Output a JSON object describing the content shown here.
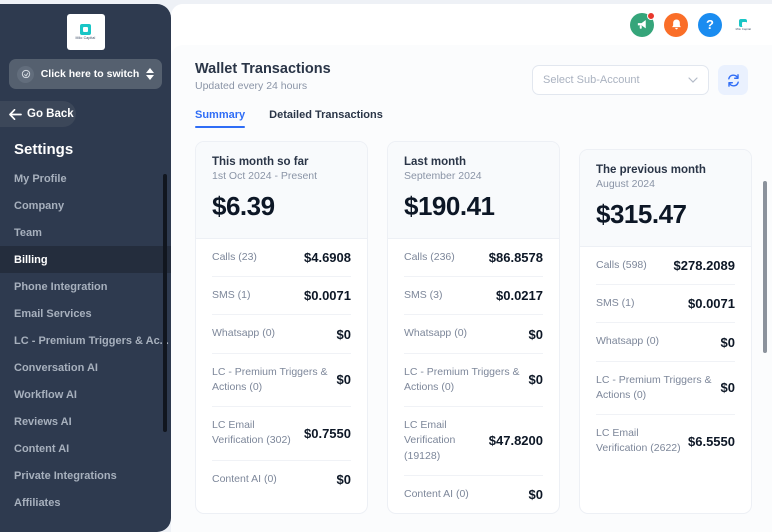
{
  "sidebar": {
    "logo_label": "Milo Capital",
    "switch": {
      "label": "Click here to switch",
      "icon": "switch-account-icon"
    },
    "go_back": {
      "label": "Go Back",
      "icon": "arrow-left-icon"
    },
    "section_title": "Settings",
    "items": [
      {
        "label": "My Profile",
        "active": false
      },
      {
        "label": "Company",
        "active": false
      },
      {
        "label": "Team",
        "active": false
      },
      {
        "label": "Billing",
        "active": true
      },
      {
        "label": "Phone Integration",
        "active": false
      },
      {
        "label": "Email Services",
        "active": false
      },
      {
        "label": "LC - Premium Triggers & Ac...",
        "active": false
      },
      {
        "label": "Conversation AI",
        "active": false
      },
      {
        "label": "Workflow AI",
        "active": false
      },
      {
        "label": "Reviews AI",
        "active": false
      },
      {
        "label": "Content AI",
        "active": false
      },
      {
        "label": "Private Integrations",
        "active": false
      },
      {
        "label": "Affiliates",
        "active": false
      }
    ]
  },
  "topbar": {
    "icons": [
      {
        "name": "announcement-icon",
        "has_badge": true,
        "color": "#35a57a"
      },
      {
        "name": "notification-bell-icon",
        "has_badge": false,
        "color": "#fa6e28"
      },
      {
        "name": "help-icon",
        "glyph": "?",
        "color": "#1a8cf0"
      },
      {
        "name": "brand-logo-icon",
        "label": "Milo Capital"
      }
    ]
  },
  "header": {
    "title": "Wallet Transactions",
    "subtitle": "Updated every 24 hours",
    "sub_account_select": {
      "placeholder": "Select Sub-Account",
      "value": ""
    },
    "refresh_label": "refresh-icon"
  },
  "tabs": [
    {
      "label": "Summary",
      "active": true
    },
    {
      "label": "Detailed Transactions",
      "active": false
    }
  ],
  "cards": [
    {
      "title": "This month so far",
      "range": "1st Oct 2024 - Present",
      "total": "$6.39",
      "shifted": false,
      "rows": [
        {
          "label": "Calls (23)",
          "value": "$4.6908"
        },
        {
          "label": "SMS (1)",
          "value": "$0.0071"
        },
        {
          "label": "Whatsapp (0)",
          "value": "$0"
        },
        {
          "label": "LC - Premium Triggers & Actions (0)",
          "value": "$0"
        },
        {
          "label": "LC Email Verification (302)",
          "value": "$0.7550"
        },
        {
          "label": "Content AI (0)",
          "value": "$0"
        }
      ]
    },
    {
      "title": "Last month",
      "range": "September 2024",
      "total": "$190.41",
      "shifted": false,
      "rows": [
        {
          "label": "Calls (236)",
          "value": "$86.8578"
        },
        {
          "label": "SMS (3)",
          "value": "$0.0217"
        },
        {
          "label": "Whatsapp (0)",
          "value": "$0"
        },
        {
          "label": "LC - Premium Triggers & Actions (0)",
          "value": "$0"
        },
        {
          "label": "LC Email Verification (19128)",
          "value": "$47.8200"
        },
        {
          "label": "Content AI (0)",
          "value": "$0"
        }
      ]
    },
    {
      "title": "The previous month",
      "range": "August 2024",
      "total": "$315.47",
      "shifted": true,
      "rows": [
        {
          "label": "Calls (598)",
          "value": "$278.2089"
        },
        {
          "label": "SMS (1)",
          "value": "$0.0071"
        },
        {
          "label": "Whatsapp (0)",
          "value": "$0"
        },
        {
          "label": "LC - Premium Triggers & Actions (0)",
          "value": "$0"
        },
        {
          "label": "LC Email Verification (2622)",
          "value": "$6.5550"
        }
      ]
    }
  ],
  "colors": {
    "sidebar_bg": "#2e3a4f",
    "sidebar_active": "#242d3d",
    "accent_blue": "#2f6df6",
    "text_dark": "#0d1726",
    "text_muted": "#7d879a"
  }
}
